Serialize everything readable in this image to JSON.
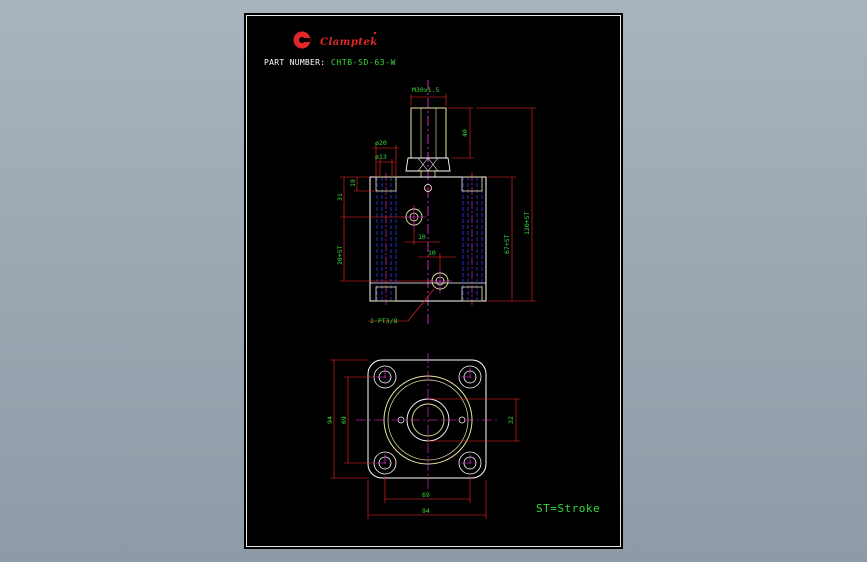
{
  "brand": "Clamptek",
  "colors": {
    "background": "#8e9aa6",
    "sheet": "#000000",
    "outline": "#ffffff",
    "body": "#e8e4a0",
    "hidden": "#2f3cff",
    "center": "#ff2df0",
    "dimension": "#ff2a2a",
    "text": "#36d83c",
    "logo": "#e0282a"
  },
  "title": {
    "part_number_label": "PART NUMBER:",
    "part_number_value": "CHTB-SD-63-W"
  },
  "dimensions": {
    "thread": "M30x1.5",
    "rod_length": "40",
    "dia_outer": "ø20",
    "dia_inner": "ø13",
    "height_31": "31",
    "height_19": "19",
    "total_length": "120+ST",
    "body_length": "67+ST",
    "port_spacing": "20+ST",
    "offset_10a": "10",
    "offset_10b": "10",
    "ports": "2-PT3/8",
    "square_94_v": "94",
    "pitch_69_v": "69",
    "flat_32": "32",
    "pitch_69_h": "69",
    "square_94_h": "94"
  },
  "note": "ST=Stroke"
}
